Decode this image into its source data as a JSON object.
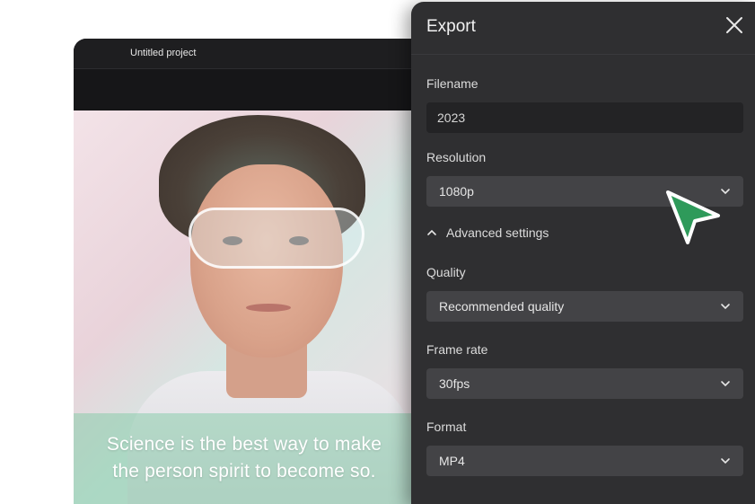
{
  "editor": {
    "project_name": "Untitled project",
    "caption_line1": "Science is the best way to make",
    "caption_line2": "the person spirit to become so."
  },
  "export": {
    "title": "Export",
    "close_icon": "close-icon",
    "filename": {
      "label": "Filename",
      "value": "2023"
    },
    "resolution": {
      "label": "Resolution",
      "value": "1080p"
    },
    "advanced": {
      "label": "Advanced settings",
      "icon": "chevron-up-icon",
      "expanded": true
    },
    "quality": {
      "label": "Quality",
      "value": "Recommended quality"
    },
    "frame_rate": {
      "label": "Frame rate",
      "value": "30fps"
    },
    "format": {
      "label": "Format",
      "value": "MP4"
    }
  },
  "colors": {
    "panel_bg": "#2f2f31",
    "field_bg": "#434346",
    "cursor": "#2e9a5a"
  },
  "cursor": {
    "icon": "pointer-cursor-icon"
  }
}
